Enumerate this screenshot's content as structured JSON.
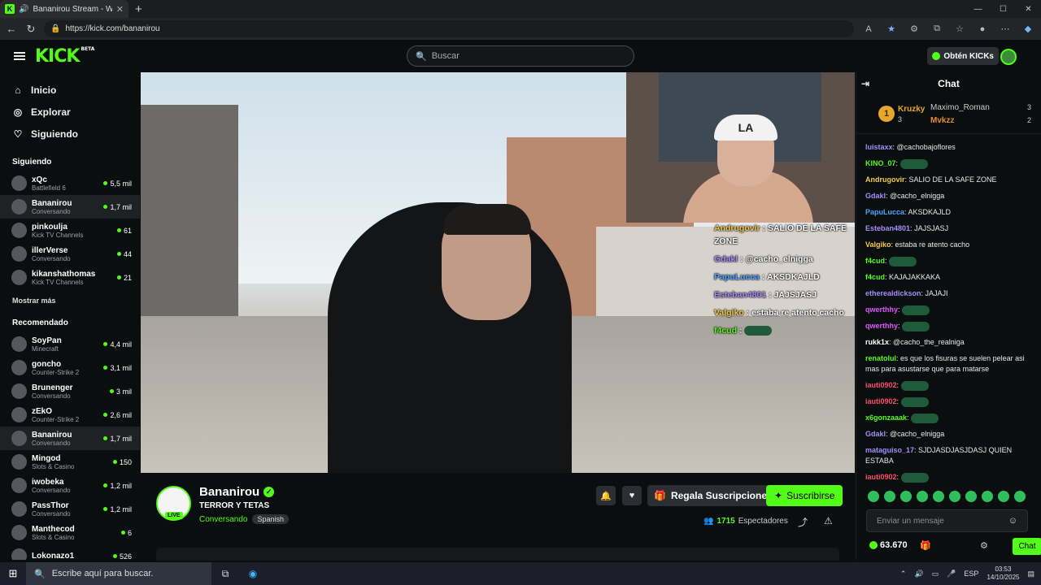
{
  "browser": {
    "tab_title": "Bananirou Stream - Watch L",
    "url": "https://kick.com/bananirou",
    "icons": [
      "back-icon",
      "refresh-icon",
      "lock-icon",
      "read-aloud-icon",
      "favorite-icon",
      "extensions-icon",
      "split-icon",
      "collections-icon",
      "profile-icon",
      "more-icon",
      "copilot-icon"
    ]
  },
  "header": {
    "logo": "KICK",
    "beta": "BETA",
    "search_placeholder": "Buscar",
    "get_kicks": "Obtén KICKs"
  },
  "sidebar": {
    "nav": [
      {
        "label": "Inicio",
        "icon": "home-icon"
      },
      {
        "label": "Explorar",
        "icon": "compass-icon"
      },
      {
        "label": "Siguiendo",
        "icon": "heart-icon"
      }
    ],
    "following_title": "Siguiendo",
    "following": [
      {
        "name": "xQc",
        "cat": "Battlefield 6",
        "viewers": "5,5 mil"
      },
      {
        "name": "Bananirou",
        "cat": "Conversando",
        "viewers": "1,7 mil"
      },
      {
        "name": "pinkoulja",
        "cat": "Kick TV Channels",
        "viewers": "61"
      },
      {
        "name": "illerVerse",
        "cat": "Conversando",
        "viewers": "44"
      },
      {
        "name": "kikanshathomas",
        "cat": "Kick TV Channels",
        "viewers": "21"
      }
    ],
    "show_more": "Mostrar más",
    "recommended_title": "Recomendado",
    "recommended": [
      {
        "name": "SoyPan",
        "cat": "Minecraft",
        "viewers": "4,4 mil"
      },
      {
        "name": "goncho",
        "cat": "Counter-Strike 2",
        "viewers": "3,1 mil"
      },
      {
        "name": "Brunenger",
        "cat": "Conversando",
        "viewers": "3 mil"
      },
      {
        "name": "zEkO",
        "cat": "Counter-Strike 2",
        "viewers": "2,6 mil"
      },
      {
        "name": "Bananirou",
        "cat": "Conversando",
        "viewers": "1,7 mil"
      },
      {
        "name": "Mingod",
        "cat": "Slots & Casino",
        "viewers": "150"
      },
      {
        "name": "iwobeka",
        "cat": "Conversando",
        "viewers": "1,2 mil"
      },
      {
        "name": "PassThor",
        "cat": "Conversando",
        "viewers": "1,2 mil"
      },
      {
        "name": "Manthecod",
        "cat": "Slots & Casino",
        "viewers": "6"
      },
      {
        "name": "Lokonazo1",
        "cat": "",
        "viewers": "526"
      }
    ]
  },
  "video": {
    "cam_cap_text": "LA",
    "overlay_chat": [
      {
        "user": "Andrugovir",
        "color": "#f2c94c",
        "text": "SALIO DE LA SAFE ZONE"
      },
      {
        "user": "Gdakl",
        "color": "#a78bfa",
        "text": "@cacho_elnigga"
      },
      {
        "user": "PapuLucca",
        "color": "#4da3ff",
        "text": "AKSDKAJLD"
      },
      {
        "user": "Esteban4801",
        "color": "#a78bfa",
        "text": "JAJSJASJ"
      },
      {
        "user": "Valgiko",
        "color": "#f2c94c",
        "text": "estaba re atento cacho"
      },
      {
        "user": "f4cud",
        "color": "#53fc18",
        "text": ""
      }
    ]
  },
  "stream": {
    "name": "Bananirou",
    "title": "TERROR Y TETAS",
    "category": "Conversando",
    "language": "Spanish",
    "live": "LIVE",
    "gift_label": "Regala Suscripciones",
    "subscribe_label": "Suscribirse",
    "viewers": "1715",
    "viewers_label": "Espectadores"
  },
  "chat": {
    "title": "Chat",
    "leaderboard": {
      "first": {
        "rank": "1",
        "name": "Kruzky",
        "count": "3"
      },
      "second": {
        "name": "Maximo_Roman",
        "count": "3"
      },
      "third": {
        "name": "Mvkzz",
        "count": "2"
      }
    },
    "messages": [
      {
        "user": "luistaxx",
        "color": "#a78bfa",
        "text": "@cachobajoflores",
        "emote": false
      },
      {
        "user": "KINO_07",
        "color": "#53fc18",
        "text": "",
        "emote": true
      },
      {
        "user": "Andrugovir",
        "color": "#f2c94c",
        "text": "SALIO DE LA SAFE ZONE",
        "emote": false
      },
      {
        "user": "Gdakl",
        "color": "#a78bfa",
        "text": "@cacho_elnigga",
        "emote": false
      },
      {
        "user": "PapuLucca",
        "color": "#4da3ff",
        "text": "AKSDKAJLD",
        "emote": false
      },
      {
        "user": "Esteban4801",
        "color": "#a78bfa",
        "text": "JAJSJASJ",
        "emote": false
      },
      {
        "user": "Valgiko",
        "color": "#f2c94c",
        "text": "estaba re atento cacho",
        "emote": false
      },
      {
        "user": "f4cud",
        "color": "#53fc18",
        "text": "",
        "emote": true
      },
      {
        "user": "f4cud",
        "color": "#53fc18",
        "text": "KAJAJAKKAKA",
        "emote": false
      },
      {
        "user": "etherealdickson",
        "color": "#a78bfa",
        "text": "JAJAJI",
        "emote": false
      },
      {
        "user": "qwerthhy",
        "color": "#e056fd",
        "text": "",
        "emote": true
      },
      {
        "user": "qwerthhy",
        "color": "#e056fd",
        "text": "",
        "emote": true
      },
      {
        "user": "rukk1x",
        "color": "#ffffff",
        "text": "@cacho_the_realniga",
        "emote": false
      },
      {
        "user": "renatolul",
        "color": "#53fc18",
        "text": "es que los fisuras se suelen pelear asi mas para asustarse que para matarse",
        "emote": false
      },
      {
        "user": "iauti0902",
        "color": "#ff4d6d",
        "text": "",
        "emote": true
      },
      {
        "user": "iauti0902",
        "color": "#ff4d6d",
        "text": "",
        "emote": true
      },
      {
        "user": "x6gonzaaak",
        "color": "#53fc18",
        "text": "",
        "emote": true
      },
      {
        "user": "Gdakl",
        "color": "#a78bfa",
        "text": "@cacho_elnigga",
        "emote": false
      },
      {
        "user": "mataguiso_17",
        "color": "#a78bfa",
        "text": "SJDJASDJASJDASJ QUIEN ESTABA",
        "emote": false
      },
      {
        "user": "iauti0902",
        "color": "#ff4d6d",
        "text": "",
        "emote": true
      }
    ],
    "input_placeholder": "Enviar un mensaje",
    "kicks_balance": "63.670",
    "send_label": "Chat"
  },
  "taskbar": {
    "search_placeholder": "Escribe aquí para buscar.",
    "lang": "ESP",
    "time": "03:53",
    "date": "14/10/2025"
  },
  "colors": {
    "accent": "#53fc18",
    "bg": "#0b0e0f"
  }
}
